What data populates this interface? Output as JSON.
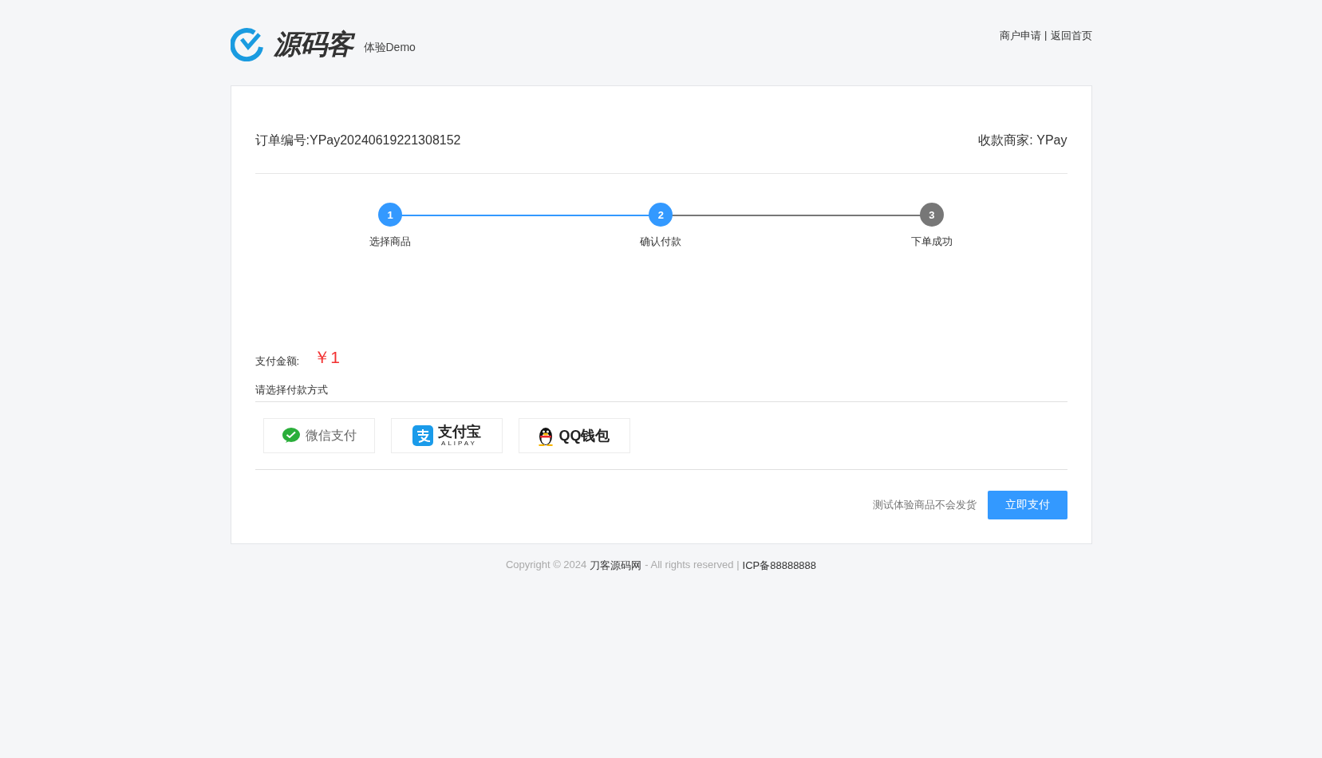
{
  "header": {
    "logo_text": "源码客",
    "subtitle": "体验Demo",
    "links": [
      "商户申请",
      "返回首页"
    ],
    "separator": "|"
  },
  "order": {
    "number_label": "订单编号:",
    "number": "YPay20240619221308152",
    "merchant_label": "收款商家:",
    "merchant": "YPay"
  },
  "steps": [
    {
      "number": "1",
      "label": "选择商品",
      "completed": true
    },
    {
      "number": "2",
      "label": "确认付款",
      "completed": true
    },
    {
      "number": "3",
      "label": "下单成功",
      "completed": false
    }
  ],
  "amount": {
    "label": "支付金额:",
    "value": "￥1"
  },
  "method_heading": "请选择付款方式",
  "methods": [
    {
      "kind": "wechat",
      "label": "微信支付"
    },
    {
      "kind": "alipay",
      "label": "支付宝",
      "sublabel": "ALIPAY"
    },
    {
      "kind": "qq",
      "label": "QQ钱包"
    }
  ],
  "note": "测试体验商品不会发货",
  "pay_button": "立即支付",
  "footer": {
    "copyright": "Copyright © 2024",
    "site": "刀客源码网",
    "rights": "- All rights reserved |",
    "icp": "ICP备88888888"
  }
}
